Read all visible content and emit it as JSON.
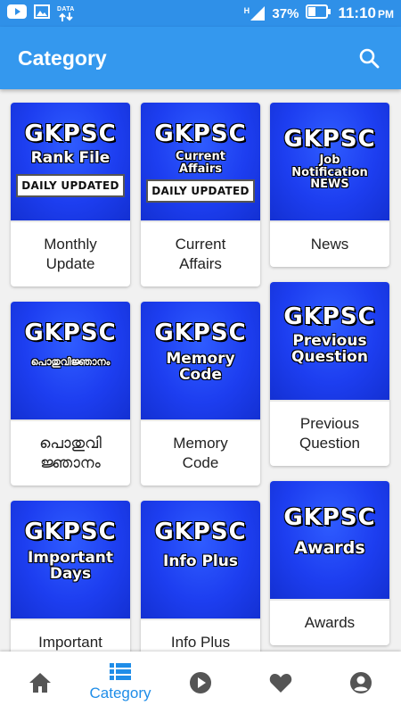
{
  "status_bar": {
    "data_label": "DATA",
    "signal_label": "H",
    "battery_percent": "37%",
    "time": "11:10",
    "ampm": "PM"
  },
  "app_bar": {
    "title": "Category"
  },
  "cards": [
    {
      "brand": "GKPSC",
      "sub": "Rank File",
      "badge": "DAILY UPDATED",
      "label": "Monthly\nUpdate"
    },
    {
      "brand": "GKPSC",
      "sub": "Current\nAffairs",
      "badge": "DAILY UPDATED",
      "label": "Current\nAffairs"
    },
    {
      "brand": "GKPSC",
      "sub": "Job\nNotification\nNEWS",
      "label": "News"
    },
    {
      "brand": "GKPSC",
      "sub": "പൊതുവിജ്ഞാനം",
      "label": "പൊതുവി\nജ്ഞാനം"
    },
    {
      "brand": "GKPSC",
      "sub": "Memory\nCode",
      "label": "Memory\nCode"
    },
    {
      "brand": "GKPSC",
      "sub": "Previous\nQuestion",
      "label": "Previous\nQuestion"
    },
    {
      "brand": "GKPSC",
      "sub": "Important\nDays",
      "label": "Important"
    },
    {
      "brand": "GKPSC",
      "sub": "Info Plus",
      "label": "Info Plus"
    },
    {
      "brand": "GKPSC",
      "sub": "Awards",
      "label": "Awards"
    }
  ],
  "bottom_nav": {
    "home_icon": "home-icon",
    "category_label": "Category",
    "play_icon": "play-icon",
    "heart_icon": "heart-icon",
    "account_icon": "account-icon"
  },
  "colors": {
    "primary": "#3498ee",
    "status_bar": "#2f90e8",
    "card_thumb": "#1d3ef0",
    "active_nav": "#1f8de8"
  }
}
